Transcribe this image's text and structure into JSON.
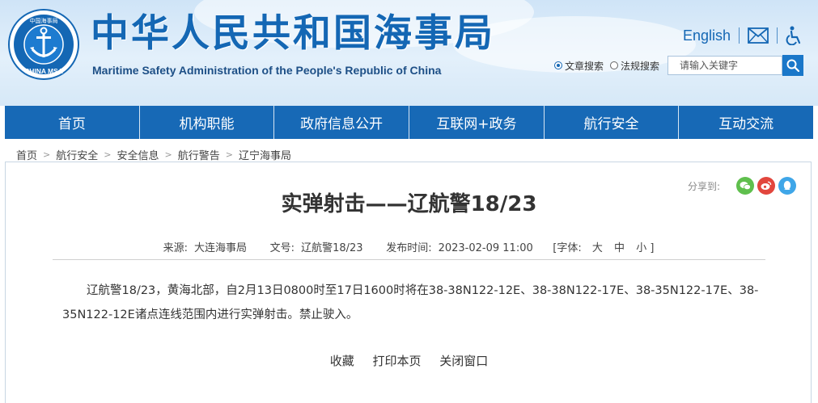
{
  "header": {
    "logo_text": "中国海事局 CHINA MSA",
    "title": "中华人民共和国海事局",
    "subtitle": "Maritime Safety Administration of the People's Republic of China",
    "english_link": "English",
    "mail_icon": "mail-icon",
    "accessibility_icon": "accessibility-icon"
  },
  "search": {
    "option_article": "文章搜索",
    "option_law": "法规搜索",
    "selected": "文章搜索",
    "placeholder": "请输入关键字",
    "button_icon": "search-icon"
  },
  "nav": {
    "items": [
      "首页",
      "机构职能",
      "政府信息公开",
      "互联网+政务",
      "航行安全",
      "互动交流"
    ]
  },
  "breadcrumb": [
    "首页",
    "航行安全",
    "安全信息",
    "航行警告",
    "辽宁海事局"
  ],
  "share": {
    "label": "分享到:",
    "icons": [
      "wechat-icon",
      "weibo-icon",
      "qq-icon"
    ]
  },
  "article": {
    "title": "实弹射击——辽航警18/23",
    "source_label": "来源:",
    "source": "大连海事局",
    "doc_no_label": "文号:",
    "doc_no": "辽航警18/23",
    "publish_label": "发布时间:",
    "publish_time": "2023-02-09 11:00",
    "font_label": "[字体:",
    "font_large": "大",
    "font_medium": "中",
    "font_small": "小 ]",
    "body": "辽航警18/23，黄海北部，自2月13日0800时至17日1600时将在38-38N122-12E、38-38N122-17E、38-35N122-17E、38-35N122-12E诸点连线范围内进行实弹射击。禁止驶入。"
  },
  "actions": {
    "collect": "收藏",
    "print": "打印本页",
    "close": "关闭窗口"
  },
  "colors": {
    "brand_blue": "#1467b4",
    "nav_blue": "#1769b6",
    "wechat": "#5fbf4d",
    "weibo": "#e2463d",
    "qq": "#3fa6e8"
  }
}
